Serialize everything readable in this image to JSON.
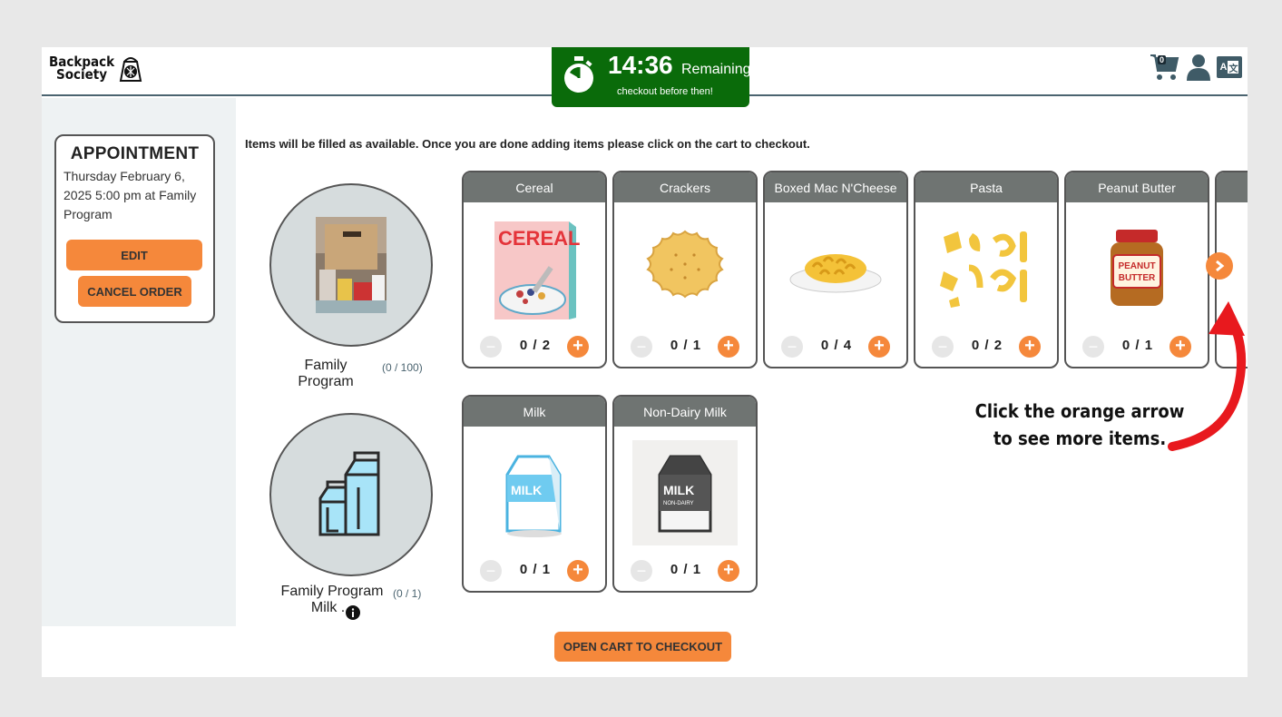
{
  "header": {
    "logo_line1": "Backpack",
    "logo_line2": "Society",
    "timer_time": "14:36",
    "timer_label": "Remaining",
    "timer_sub": "checkout before then!",
    "cart_count": "0",
    "lang_a": "A",
    "lang_b": "文"
  },
  "appointment": {
    "title": "APPOINTMENT",
    "details": "Thursday February 6, 2025 5:00 pm at Family Program",
    "edit_label": "EDIT",
    "cancel_label": "CANCEL ORDER"
  },
  "instructions": "Items will be filled as available.  Once you are done adding items please click on the cart to checkout.",
  "buckets": [
    {
      "name": "Family Program",
      "count": "(0 / 100)"
    },
    {
      "name": "Family Program Milk ...",
      "count": "(0 / 1)"
    }
  ],
  "items_row1": [
    {
      "label": "Cereal",
      "qty": "0 / 2"
    },
    {
      "label": "Crackers",
      "qty": "0 / 1"
    },
    {
      "label": "Boxed Mac N'Cheese",
      "qty": "0 / 4"
    },
    {
      "label": "Pasta",
      "qty": "0 / 2"
    },
    {
      "label": "Peanut Butter",
      "qty": "0 / 1"
    }
  ],
  "items_row2": [
    {
      "label": "Milk",
      "qty": "0 / 1"
    },
    {
      "label": "Non-Dairy Milk",
      "qty": "0 / 1"
    }
  ],
  "image_text": {
    "cereal": "CEREAL",
    "milk": "MILK",
    "nondairy_milk": "MILK",
    "nondairy_sub": "NON-DAIRY",
    "pb_line1": "PEANUT",
    "pb_line2": "BUTTER"
  },
  "callout": {
    "line1": "Click the orange arrow",
    "line2": "to see more items."
  },
  "checkout_label": "OPEN CART TO CHECKOUT",
  "colors": {
    "accent": "#f5883b",
    "timer_bg": "#0a6b0a",
    "card_header": "#6f7472",
    "callout_arrow": "#e8191e"
  }
}
